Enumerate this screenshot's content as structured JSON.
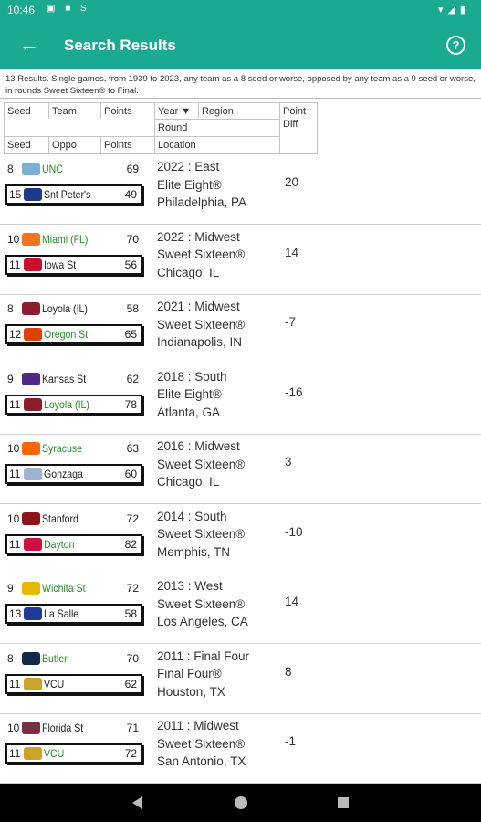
{
  "status": {
    "time": "10:46",
    "left_icons": "▣ ■ S",
    "right_icons": "▾◢▮"
  },
  "appbar": {
    "title": "Search Results",
    "back_glyph": "←",
    "help_glyph": "?"
  },
  "summary": "13 Results. Single games, from 1939 to 2023, any team as a 8 seed or worse, opposed by any team as a 9 seed or worse, in rounds Sweet Sixteen® to Final.",
  "headers": {
    "seed": "Seed",
    "team": "Team",
    "points": "Points",
    "year": "Year ▼",
    "region": "Region",
    "point_diff": "Point Diff",
    "round": "Round",
    "seed2": "Seed",
    "oppo": "Oppo.",
    "points2": "Points",
    "location": "Location"
  },
  "colors": {
    "accent": "#1aaa92",
    "green_text": "#2a8a2a"
  },
  "games": [
    {
      "t1": {
        "seed": "8",
        "name": "UNC",
        "pts": "69",
        "green": true,
        "logo": "#7bafd4"
      },
      "t2": {
        "seed": "15",
        "name": "Snt Peter's",
        "pts": "49",
        "green": false,
        "logo": "#1e3a8a"
      },
      "year_region": "2022 :  East",
      "round": "Elite Eight®",
      "location": "Philadelphia, PA",
      "diff": "20"
    },
    {
      "t1": {
        "seed": "10",
        "name": "Miami (FL)",
        "pts": "70",
        "green": true,
        "logo": "#f47321"
      },
      "t2": {
        "seed": "11",
        "name": "Iowa St",
        "pts": "56",
        "green": false,
        "logo": "#c8102e"
      },
      "year_region": "2022 :  Midwest",
      "round": "Sweet Sixteen®",
      "location": "Chicago, IL",
      "diff": "14"
    },
    {
      "t1": {
        "seed": "8",
        "name": "Loyola (IL)",
        "pts": "58",
        "green": false,
        "logo": "#8b1e2d"
      },
      "t2": {
        "seed": "12",
        "name": "Oregon St",
        "pts": "65",
        "green": true,
        "logo": "#dc4405"
      },
      "year_region": "2021 :  Midwest",
      "round": "Sweet Sixteen®",
      "location": "Indianapolis, IN",
      "diff": "-7"
    },
    {
      "t1": {
        "seed": "9",
        "name": "Kansas St",
        "pts": "62",
        "green": false,
        "logo": "#512888"
      },
      "t2": {
        "seed": "11",
        "name": "Loyola (IL)",
        "pts": "78",
        "green": true,
        "logo": "#8b1e2d"
      },
      "year_region": "2018 :  South",
      "round": "Elite Eight®",
      "location": "Atlanta, GA",
      "diff": "-16"
    },
    {
      "t1": {
        "seed": "10",
        "name": "Syracuse",
        "pts": "63",
        "green": true,
        "logo": "#f76900"
      },
      "t2": {
        "seed": "11",
        "name": "Gonzaga",
        "pts": "60",
        "green": false,
        "logo": "#9fb3d1"
      },
      "year_region": "2016 :  Midwest",
      "round": "Sweet Sixteen®",
      "location": "Chicago, IL",
      "diff": "3"
    },
    {
      "t1": {
        "seed": "10",
        "name": "Stanford",
        "pts": "72",
        "green": false,
        "logo": "#8c1515"
      },
      "t2": {
        "seed": "11",
        "name": "Dayton",
        "pts": "82",
        "green": true,
        "logo": "#ce1141"
      },
      "year_region": "2014 :  South",
      "round": "Sweet Sixteen®",
      "location": "Memphis, TN",
      "diff": "-10"
    },
    {
      "t1": {
        "seed": "9",
        "name": "Wichita St",
        "pts": "72",
        "green": true,
        "logo": "#e6b800"
      },
      "t2": {
        "seed": "13",
        "name": "La Salle",
        "pts": "58",
        "green": false,
        "logo": "#1f3a93"
      },
      "year_region": "2013 :  West",
      "round": "Sweet Sixteen®",
      "location": "Los Angeles, CA",
      "diff": "14"
    },
    {
      "t1": {
        "seed": "8",
        "name": "Butler",
        "pts": "70",
        "green": true,
        "logo": "#13294b"
      },
      "t2": {
        "seed": "11",
        "name": "VCU",
        "pts": "62",
        "green": false,
        "logo": "#c9a227"
      },
      "year_region": "2011 :  Final Four",
      "round": "Final Four®",
      "location": "Houston, TX",
      "diff": "8"
    },
    {
      "t1": {
        "seed": "10",
        "name": "Florida St",
        "pts": "71",
        "green": false,
        "logo": "#782f40"
      },
      "t2": {
        "seed": "11",
        "name": "VCU",
        "pts": "72",
        "green": true,
        "logo": "#c9a227"
      },
      "year_region": "2011 :  Midwest",
      "round": "Sweet Sixteen®",
      "location": "San Antonio, TX",
      "diff": "-1"
    }
  ]
}
